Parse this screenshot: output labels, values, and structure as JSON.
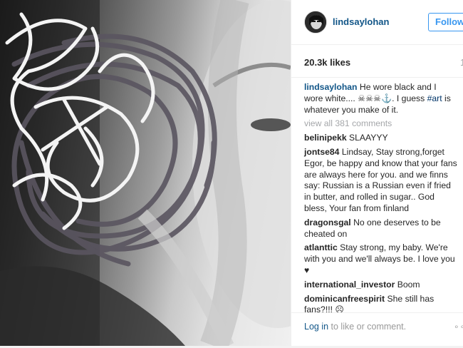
{
  "header": {
    "username": "lindsaylohan",
    "follow_label": "Follow"
  },
  "likes": {
    "count": "20.3k likes",
    "time": "1"
  },
  "caption": {
    "username": "lindsaylohan",
    "text_before_tag": " He wore black and I wore white.... ☠☠☠⚓. I guess ",
    "tag": "#art",
    "text_after_tag": " is whatever you make of it."
  },
  "view_all": "view all 381 comments",
  "comments": [
    {
      "user": "belinipekk",
      "text": " SLAAYYY"
    },
    {
      "user": "jontse84",
      "text": " Lindsay, Stay strong,forget Egor, be happy and know that your fans are always here for you. and we finns say: Russian is a Russian even if fried in butter, and rolled in sugar.. God bless, Your fan from finland"
    },
    {
      "user": "dragonsgal",
      "text": " No one deserves to be cheated on"
    },
    {
      "user": "atlanttic",
      "text": " Stay strong, my baby. We're with you and we'll always be. I love you ♥"
    },
    {
      "user": "international_investor",
      "text": " Boom"
    },
    {
      "user": "dominicanfreespirit",
      "text": " She still has fans?!!! ☹"
    }
  ],
  "footer": {
    "login_link": "Log in",
    "login_text": " to like or comment.",
    "more": "∘∘"
  },
  "colors": {
    "link_blue": "#125688",
    "follow_blue": "#3897f0",
    "muted": "#a5a7aa"
  }
}
